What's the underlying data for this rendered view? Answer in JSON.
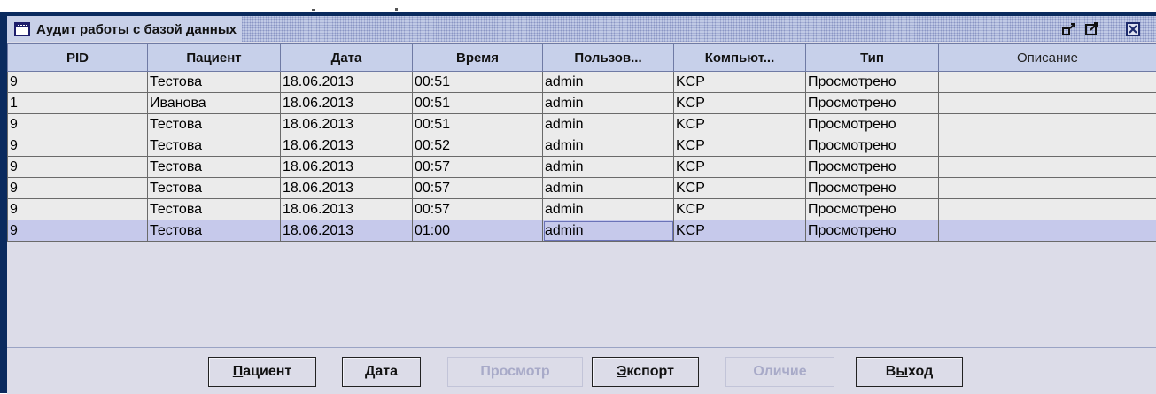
{
  "window": {
    "title": "Аудит работы с базой данных",
    "controls": {
      "restore": "▫",
      "maximize": "◩",
      "close": "✕"
    }
  },
  "table": {
    "columns": [
      "PID",
      "Пациент",
      "Дата",
      "Время",
      "Пользов...",
      "Компьют...",
      "Тип",
      "Описание"
    ],
    "rows": [
      [
        "9",
        "Тестова",
        "18.06.2013",
        "00:51",
        "admin",
        "KCP",
        "Просмотрено",
        ""
      ],
      [
        "1",
        "Иванова",
        "18.06.2013",
        "00:51",
        "admin",
        "KCP",
        "Просмотрено",
        ""
      ],
      [
        "9",
        "Тестова",
        "18.06.2013",
        "00:51",
        "admin",
        "KCP",
        "Просмотрено",
        ""
      ],
      [
        "9",
        "Тестова",
        "18.06.2013",
        "00:52",
        "admin",
        "KCP",
        "Просмотрено",
        ""
      ],
      [
        "9",
        "Тестова",
        "18.06.2013",
        "00:57",
        "admin",
        "KCP",
        "Просмотрено",
        ""
      ],
      [
        "9",
        "Тестова",
        "18.06.2013",
        "00:57",
        "admin",
        "KCP",
        "Просмотрено",
        ""
      ],
      [
        "9",
        "Тестова",
        "18.06.2013",
        "00:57",
        "admin",
        "KCP",
        "Просмотрено",
        ""
      ],
      [
        "9",
        "Тестова",
        "18.06.2013",
        "01:00",
        "admin",
        "KCP",
        "Просмотрено",
        ""
      ]
    ],
    "selected_row": 7
  },
  "buttons": {
    "patient": {
      "mn": "П",
      "rest": "ациент"
    },
    "date": "Дата",
    "view": "Просмотр",
    "export": {
      "mn": "Э",
      "rest": "кспорт"
    },
    "diff": "Оличие",
    "exit": {
      "pre": "В",
      "mn": "ы",
      "rest": "ход"
    }
  },
  "colors": {
    "titlebar": "#c2cbe6",
    "selection": "#c6c9eb",
    "frame": "#0a2a5e",
    "disabled_text": "#a8aac8"
  }
}
